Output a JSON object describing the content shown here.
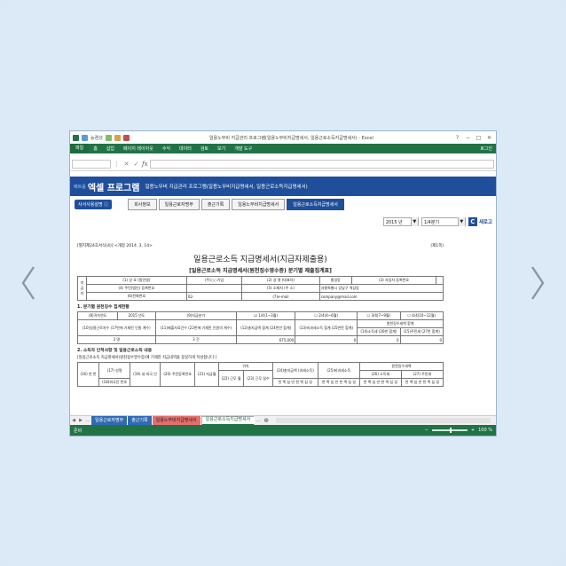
{
  "window": {
    "title": "일용노무비 지급관리 프로그램(일용노무비지급명세서, 일용근로소득지급명세서) - Excel",
    "autosave_label": "능켬셨",
    "help": "?",
    "controls": [
      "−",
      "□",
      "✕"
    ]
  },
  "ribbon": {
    "file": "파일",
    "tabs": [
      "홈",
      "삽입",
      "페이지 레이아웃",
      "수식",
      "데이터",
      "검토",
      "보기",
      "개발 도구"
    ],
    "login": "로그인"
  },
  "formula_bar": {
    "fx": "fx"
  },
  "banner": {
    "logo_small": "베트를",
    "logo_main": "엑셀 프로그램",
    "subtitle": "일용노무비 지급관리 프로그램(일용노무비지급명세서, 일용근로소득지급명세서)"
  },
  "menu": {
    "usage": "사서사용설명 ⓘ",
    "sheets": [
      "회사정보",
      "일용근로자명부",
      "출근기록",
      "일용노무비지급명세서",
      "일용근로소득지급명세서"
    ],
    "active_index": 4
  },
  "controls": {
    "year": "2015 년",
    "quarter": "1/4분기",
    "refresh": "새로고"
  },
  "document": {
    "form_no": "[별지제24호서식(4)] <개정 2014. 3. 14>",
    "page": "(제1쪽)",
    "title": "일용근로소득 지급명세서(지급자제출용)",
    "subtitle": "[일용근로소득 지급명세서(원천징수영수증) 분기별 제출집계표]",
    "payer": {
      "side": "지급자",
      "r1": [
        "(1) 상 호\n(법인명)",
        "(주)○○기업",
        "(2) 성 명\n(대표자)",
        "홍길동",
        "(3) 사업자\n등록번호",
        ""
      ],
      "r2": [
        "(4) 주민(법인)\n등록번호",
        "",
        "(5) 소재지\n(주 소)",
        "서울특별시 강남구 역삼동"
      ],
      "r3": [
        "(6)전화번호",
        "02-",
        "(7)e-mail",
        "company@mail.com"
      ]
    },
    "section1": "1. 분기별 원천징수 집계현황",
    "s1": {
      "year_label": "(8)귀속연도",
      "year_value": "2015 년도",
      "quarter_label": "(9)지급분기",
      "q": [
        "☑ 1/4(1~3월)",
        "☐ 2/4(4~6월)",
        "☐ 3/4(7~9월)",
        "☐ 4/4(10~12월)"
      ],
      "headers": [
        "(10)일용근로자수\n(17번에 기재된\n인원 계수)",
        "(11)제출자료건수\n(22번에 기재된 인원의\n계수)",
        "(12)총지급액 합계\n(24번란 합계)",
        "(13)비과세소득\n합계\n(25번란 합계)",
        "원천징수세액 합계"
      ],
      "subheaders": [
        "(14)소득세\n(26번 합계)",
        "(15)주민세\n(27번 합계)"
      ],
      "values": [
        "3 명",
        "3 건",
        "675,000",
        "0",
        "0",
        "0"
      ]
    },
    "section2": "2. 소득자 인적사항 및 일용근로소득 내용",
    "note": "[일용근로소득 지급명세서(원천징수영수증)에 기재한 지급내역을 동일하게 작성합니다.]",
    "s2": {
      "col16": "(16)\n연\n번",
      "col17": "(17)\n성명",
      "col17b": "(18)외국인\n번호",
      "col19": "(19)\n내\n외국\n인",
      "col20": "(20)\n주민등록번호",
      "col21": "(21)\n지급월",
      "col22": "귀속",
      "col24": "(24)총지급액\n(과세소득)",
      "col25": "(25)비과세소득",
      "wh": "원천징수세액",
      "col26": "(26) 소득세",
      "col27": "(27) 주민세",
      "c22": "(22)\n근무\n월",
      "c23": "(23)\n근무\n일수",
      "digits": "천 백 십 만 천 백 십 일"
    }
  },
  "sheet_tabs": {
    "tabs": [
      "일용근로자명부",
      "출근기록",
      "일용노무비지급명세서",
      "일용근로소득지급명세서"
    ],
    "styles": [
      "blue",
      "blue",
      "red",
      "sel"
    ]
  },
  "status": {
    "ready": "준비",
    "zoom": "100 %"
  }
}
